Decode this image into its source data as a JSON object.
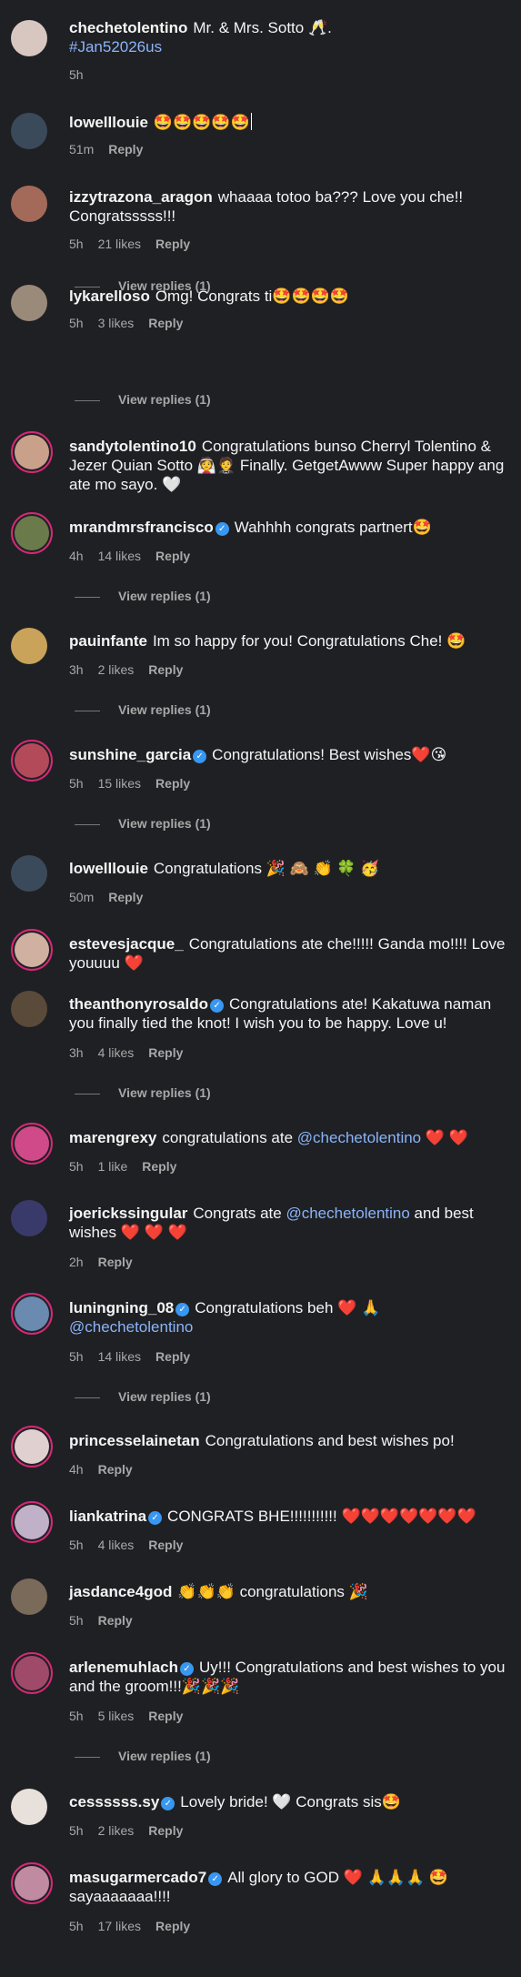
{
  "comments": [
    {
      "user": "chechetolentino",
      "text": "Mr. & Mrs. Sotto 🥂.",
      "hashtag": "#Jan52026us",
      "time": "5h",
      "likes": "",
      "reply": "",
      "view": "",
      "color": "#d8c7c0"
    },
    {
      "user": "lowelllouie",
      "text": "🤩🤩🤩🤩🤩",
      "time": "51m",
      "likes": "",
      "reply": "Reply",
      "view": "",
      "color": "#3b4a5a"
    },
    {
      "user": "izzytrazona_aragon",
      "text": "whaaaa totoo ba??? Love you che!! Congratsssss!!!",
      "time": "5h",
      "likes": "21 likes",
      "reply": "Reply",
      "view": "View replies (1)",
      "color": "#a36a5a"
    },
    {
      "user": "lykarelloso",
      "text": "Omg! Congrats ti🤩🤩🤩🤩",
      "time": "5h",
      "likes": "3 likes",
      "reply": "Reply",
      "view": "View replies (1)",
      "color": "#9a8a7a"
    },
    {
      "user": "sandytolentino10",
      "text": "Congratulations bunso Cherryl Tolentino & Jezer Quian Sotto 👰🤵 Finally. GetgetAwww Super happy ang ate mo sayo. 🤍",
      "time": "",
      "likes": "",
      "reply": "",
      "view": "",
      "color": "#c9a08a"
    },
    {
      "user": "mrandmrsfrancisco",
      "text": "Wahhhh congrats partnert🤩",
      "time": "4h",
      "likes": "14 likes",
      "reply": "Reply",
      "view": "View replies (1)",
      "color": "#6b7a4a"
    },
    {
      "user": "pauinfante",
      "text": "Im so happy for you! Congratulations Che! 🤩",
      "time": "3h",
      "likes": "2 likes",
      "reply": "Reply",
      "view": "View replies (1)",
      "color": "#c9a35a"
    },
    {
      "user": "sunshine_garcia",
      "text": "Congratulations! Best wishes❤️😘",
      "time": "5h",
      "likes": "15 likes",
      "reply": "Reply",
      "view": "View replies (1)",
      "color": "#b34a5a"
    },
    {
      "user": "lowelllouie",
      "text": "Congratulations 🎉 🙈 👏 🍀 🥳",
      "time": "50m",
      "likes": "",
      "reply": "Reply",
      "view": "",
      "color": "#3b4a5a"
    },
    {
      "user": "estevesjacque_",
      "text": "Congratulations ate che!!!!! Ganda mo!!!! Love youuuu ❤️",
      "time": "",
      "likes": "",
      "reply": "",
      "view": "",
      "color": "#d0b0a0"
    },
    {
      "user": "theanthonyrosaldo",
      "text": "Congratulations ate! Kakatuwa naman you finally tied the knot! I wish you to be happy. Love u!",
      "time": "3h",
      "likes": "4 likes",
      "reply": "Reply",
      "view": "View replies (1)",
      "color": "#5a4a3a"
    },
    {
      "user": "marengrexy",
      "text": "congratulations ate",
      "mention": "@chechetolentino",
      "tail": " ❤️ ❤️",
      "time": "5h",
      "likes": "1 like",
      "reply": "Reply",
      "view": "",
      "color": "#d04a8a"
    },
    {
      "user": "joerickssingular",
      "text": "Congrats ate",
      "mention": "@chechetolentino",
      "tail": " and best wishes ❤️ ❤️ ❤️",
      "time": "2h",
      "likes": "",
      "reply": "Reply",
      "view": "",
      "color": "#3a3a6a"
    },
    {
      "user": "luningning_08",
      "text": "Congratulations beh ❤️ 🙏",
      "mention": "@chechetolentino",
      "time": "5h",
      "likes": "14 likes",
      "reply": "Reply",
      "view": "View replies (1)",
      "color": "#6a8ab0"
    },
    {
      "user": "princesselainetan",
      "text": "Congratulations and best wishes po!",
      "time": "4h",
      "likes": "",
      "reply": "Reply",
      "view": "",
      "color": "#e0d0d0"
    },
    {
      "user": "liankatrina",
      "text": "CONGRATS BHE!!!!!!!!!!! ❤️❤️❤️❤️❤️❤️❤️",
      "time": "5h",
      "likes": "4 likes",
      "reply": "Reply",
      "view": "",
      "color": "#c0b0c8"
    },
    {
      "user": "jasdance4god",
      "text": "👏👏👏 congratulations 🎉",
      "time": "5h",
      "likes": "",
      "reply": "Reply",
      "view": "",
      "color": "#7a6a5a"
    },
    {
      "user": "arlenemuhlach",
      "text": "Uy!!! Congratulations and best wishes to you and the groom!!!🎉🎉🎉",
      "time": "5h",
      "likes": "5 likes",
      "reply": "Reply",
      "view": "View replies (1)",
      "color": "#a04a6a"
    },
    {
      "user": "cessssss.sy",
      "text": "Lovely bride! 🤍 Congrats sis🤩",
      "time": "5h",
      "likes": "2 likes",
      "reply": "Reply",
      "view": "",
      "color": "#e8e0da"
    },
    {
      "user": "masugarmercado7",
      "text": "All glory to GOD ❤️ 🙏🙏🙏 🤩 sayaaaaaaa!!!!",
      "time": "5h",
      "likes": "17 likes",
      "reply": "Reply",
      "view": "",
      "color": "#c08aa0"
    }
  ]
}
